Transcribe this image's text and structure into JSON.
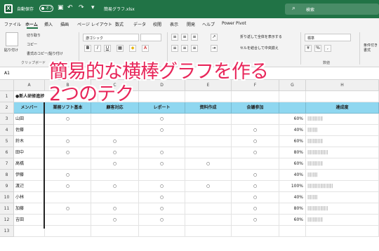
{
  "titlebar": {
    "autosave_label": "自動保存",
    "autosave_state": "オフ",
    "filename": "簡易グラフ.xlsx",
    "search_label": "検索",
    "bg_color": "#217346"
  },
  "menu": [
    "ファイル",
    "ホーム",
    "挿入",
    "描画",
    "ページ レイアウト",
    "数式",
    "データ",
    "校閲",
    "表示",
    "開発",
    "ヘルプ",
    "Power Pivot"
  ],
  "ribbon": {
    "paste": "貼り付け",
    "cut": "切り取り",
    "copy": "コピー",
    "format_painter": "書式のコピー/貼り付け",
    "clipboard_group": "クリップボード",
    "font_name": "游ゴシック",
    "bold": "B",
    "italic": "I",
    "underline": "U",
    "wrap_text": "折り返して全体を表示する",
    "merge_center": "セルを結合して中央揃え",
    "number_format": "標準",
    "number_group": "数値",
    "conditional_format": "条件付き書式"
  },
  "formula_bar": {
    "cell_ref": "A1"
  },
  "overlay": {
    "line1": "簡易的な横棒グラフを作る",
    "line2": "2つのテク"
  },
  "columns": [
    "A",
    "B",
    "C",
    "D",
    "E",
    "F",
    "G",
    "H"
  ],
  "rows": [
    "1",
    "2",
    "3",
    "4",
    "5",
    "6",
    "7",
    "8",
    "9",
    "10",
    "11",
    "12",
    "13"
  ],
  "sheet": {
    "a1": "●新人研修進捗",
    "headers": [
      "メンバー",
      "業務ソフト基本",
      "顧客対応",
      "レポート",
      "資料作成",
      "会議参加",
      "",
      "達成度"
    ],
    "mark": "○",
    "data": [
      {
        "name": "山田",
        "b": true,
        "c": false,
        "d": true,
        "e": false,
        "f": false,
        "pct": "60%",
        "bars": "||||||||||||"
      },
      {
        "name": "佐藤",
        "b": false,
        "c": false,
        "d": true,
        "e": false,
        "f": true,
        "pct": "40%",
        "bars": "||||||||"
      },
      {
        "name": "鈴木",
        "b": true,
        "c": true,
        "d": false,
        "e": false,
        "f": true,
        "pct": "60%",
        "bars": "||||||||||||"
      },
      {
        "name": "田中",
        "b": true,
        "c": true,
        "d": true,
        "e": false,
        "f": true,
        "pct": "80%",
        "bars": "||||||||||||||||"
      },
      {
        "name": "高橋",
        "b": false,
        "c": true,
        "d": true,
        "e": true,
        "f": false,
        "pct": "60%",
        "bars": "||||||||||||"
      },
      {
        "name": "伊藤",
        "b": true,
        "c": false,
        "d": false,
        "e": false,
        "f": true,
        "pct": "40%",
        "bars": "||||||||"
      },
      {
        "name": "渡辺",
        "b": true,
        "c": true,
        "d": true,
        "e": true,
        "f": true,
        "pct": "100%",
        "bars": "||||||||||||||||||||"
      },
      {
        "name": "小林",
        "b": false,
        "c": false,
        "d": true,
        "e": false,
        "f": true,
        "pct": "40%",
        "bars": "||||||||"
      },
      {
        "name": "加藤",
        "b": true,
        "c": true,
        "d": true,
        "e": false,
        "f": true,
        "pct": "80%",
        "bars": "||||||||||||||||"
      },
      {
        "name": "吉田",
        "b": false,
        "c": true,
        "d": true,
        "e": false,
        "f": true,
        "pct": "60%",
        "bars": "||||||||||||"
      }
    ]
  }
}
